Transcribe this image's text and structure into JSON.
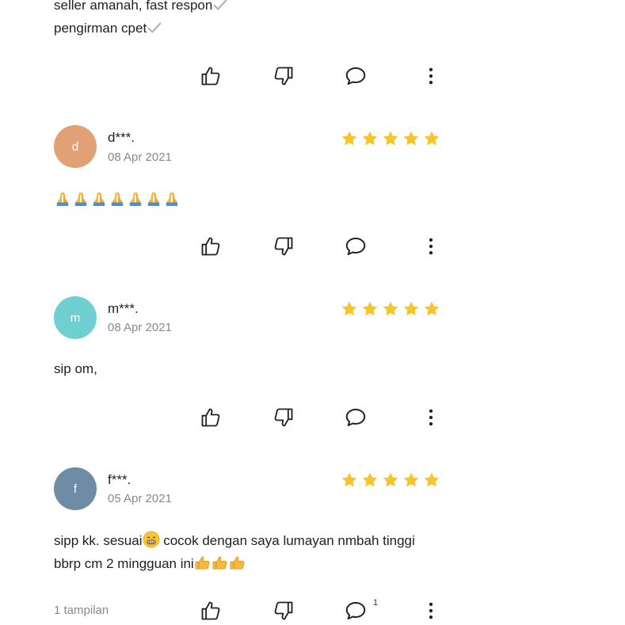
{
  "top_review": {
    "line1": "seller amanah, fast respon",
    "line2": "pengirman cpet"
  },
  "reviews": [
    {
      "avatar_letter": "d",
      "avatar_color": "#E1A174",
      "username": "d***.",
      "date": "08 Apr 2021",
      "rating": 5,
      "text": "",
      "emoji": "folded-hands x7"
    },
    {
      "avatar_letter": "m",
      "avatar_color": "#6FCFD1",
      "username": "m***.",
      "date": "08 Apr 2021",
      "rating": 5,
      "text": "sip om,"
    },
    {
      "avatar_letter": "f",
      "avatar_color": "#6F8CA6",
      "username": "f***.",
      "date": "05 Apr 2021",
      "rating": 5,
      "text_line1_a": "sipp kk. sesuai",
      "text_line1_b": " cocok dengan saya lumayan nmbah tinggi",
      "text_line2": "bbrp cm 2 mingguan ini"
    }
  ],
  "footer": {
    "views": "1 tampilan",
    "comment_count": "1"
  },
  "colors": {
    "star": "#F7C52B",
    "icon": "#222222",
    "muted": "#8A8A8A"
  },
  "icons": [
    "thumbs-up-icon",
    "thumbs-down-icon",
    "comment-icon",
    "more-vertical-icon",
    "star-icon"
  ]
}
